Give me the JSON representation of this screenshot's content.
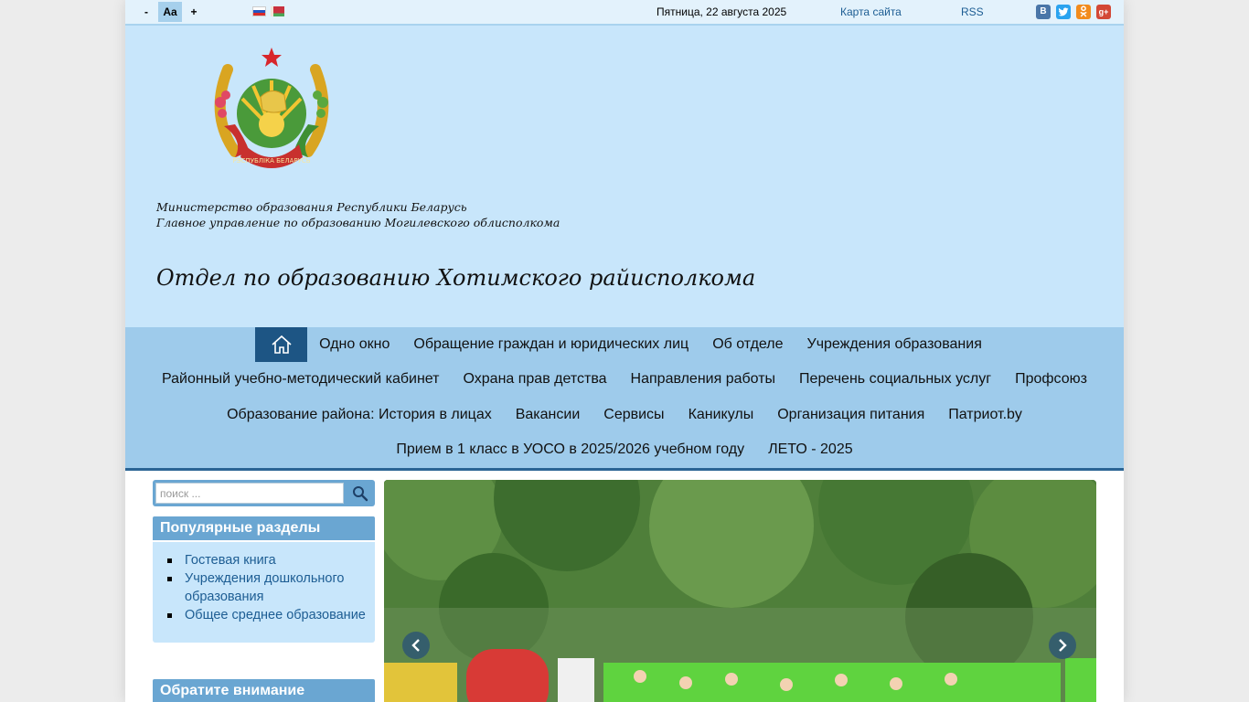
{
  "topbar": {
    "font_minus": "-",
    "font_normal": "Aa",
    "font_plus": "+",
    "date": "Пятница, 22 августа 2025",
    "sitemap": "Карта сайта",
    "rss": "RSS",
    "social": [
      "vk-icon",
      "twitter-icon",
      "odnoklassniki-icon",
      "google-plus-icon"
    ]
  },
  "header": {
    "ministry_line1": "Министерство образования Республики Беларусь",
    "ministry_line2": "Главное управление по образованию Могилевского облисполкома",
    "dept_title": "Отдел по образованию Хотимского райисполкома",
    "emblem_ribbon_text": "РЭСПУБЛІКА БЕЛАРУСЬ"
  },
  "nav": {
    "row1": [
      "Одно окно",
      "Обращение граждан и юридических лиц",
      "Об отделе",
      "Учреждения образования"
    ],
    "row2": [
      "Районный учебно-методический кабинет",
      "Охрана прав детства",
      "Направления работы",
      "Перечень социальных услуг",
      "Профсоюз"
    ],
    "row3": [
      "Образование района: История в лицах",
      "Вакансии",
      "Сервисы",
      "Каникулы",
      "Организация питания",
      "Патриот.by"
    ],
    "row4": [
      "Прием в 1 класс в УОСО в 2025/2026 учебном году",
      "ЛЕТО - 2025"
    ]
  },
  "search": {
    "placeholder": "поиск ..."
  },
  "popular": {
    "title": "Популярные разделы",
    "items": [
      "Гостевая книга",
      "Учреждения дошкольного образования",
      "Общее среднее образование"
    ]
  },
  "attention": {
    "title": "Обратите внимание"
  },
  "colors": {
    "header_bg": "#c8e6fb",
    "nav_bg": "#9ecbeb",
    "accent": "#1d5584",
    "module_head": "#6aa6d2"
  }
}
